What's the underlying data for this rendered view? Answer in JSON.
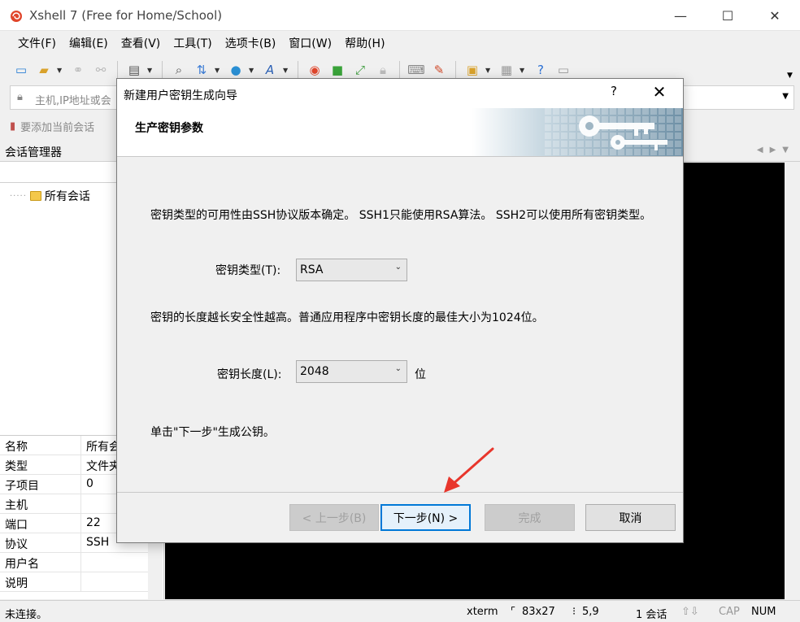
{
  "window": {
    "title": "Xshell 7 (Free for Home/School)",
    "min_glyph": "—",
    "max_glyph": "☐",
    "close_glyph": "✕"
  },
  "menu": [
    "文件(F)",
    "编辑(E)",
    "查看(V)",
    "工具(T)",
    "选项卡(B)",
    "窗口(W)",
    "帮助(H)"
  ],
  "toolbar": {
    "icons": [
      "new-session-icon",
      "open-folder-icon",
      "reconnect-icon",
      "disconnect-icon",
      "properties-icon",
      "find-icon",
      "transfer-icon",
      "globe-icon",
      "font-icon",
      "xshell-icon",
      "xftp-icon",
      "fullscreen-icon",
      "lock-icon",
      "keyboard-icon",
      "highlight-icon",
      "add-session-icon",
      "layout-icon",
      "help-icon",
      "chat-icon"
    ]
  },
  "address": {
    "placeholder": "主机,IP地址或会"
  },
  "hint": {
    "text": "要添加当前会话"
  },
  "session_manager": {
    "title": "会话管理器",
    "tree_root": "所有会话",
    "props": [
      {
        "k": "名称",
        "v": "所有会"
      },
      {
        "k": "类型",
        "v": "文件夹"
      },
      {
        "k": "子项目",
        "v": "0"
      },
      {
        "k": "主机",
        "v": ""
      },
      {
        "k": "端口",
        "v": "22"
      },
      {
        "k": "协议",
        "v": "SSH"
      },
      {
        "k": "用户名",
        "v": ""
      },
      {
        "k": "说明",
        "v": ""
      }
    ]
  },
  "status": {
    "connection": "未连接。",
    "term": "xterm",
    "size": "83x27",
    "cursor": "5,9",
    "sessions": "1 会话",
    "caps": "CAP",
    "num": "NUM"
  },
  "dialog": {
    "title": "新建用户密钥生成向导",
    "help": "?",
    "close": "✕",
    "banner_title": "生产密钥参数",
    "desc1": "密钥类型的可用性由SSH协议版本确定。 SSH1只能使用RSA算法。 SSH2可以使用所有密钥类型。",
    "key_type_label": "密钥类型(T):",
    "key_type_value": "RSA",
    "desc2": "密钥的长度越长安全性越高。普通应用程序中密钥长度的最佳大小为1024位。",
    "key_length_label": "密钥长度(L):",
    "key_length_value": "2048",
    "key_length_unit": "位",
    "desc3": "单击\"下一步\"生成公钥。",
    "btn_back": "< 上一步(B)",
    "btn_next": "下一步(N) >",
    "btn_finish": "完成",
    "btn_cancel": "取消"
  },
  "colors": {
    "accent": "#0078d7",
    "annotation": "#e8362c",
    "terminal_bg": "#000000"
  }
}
